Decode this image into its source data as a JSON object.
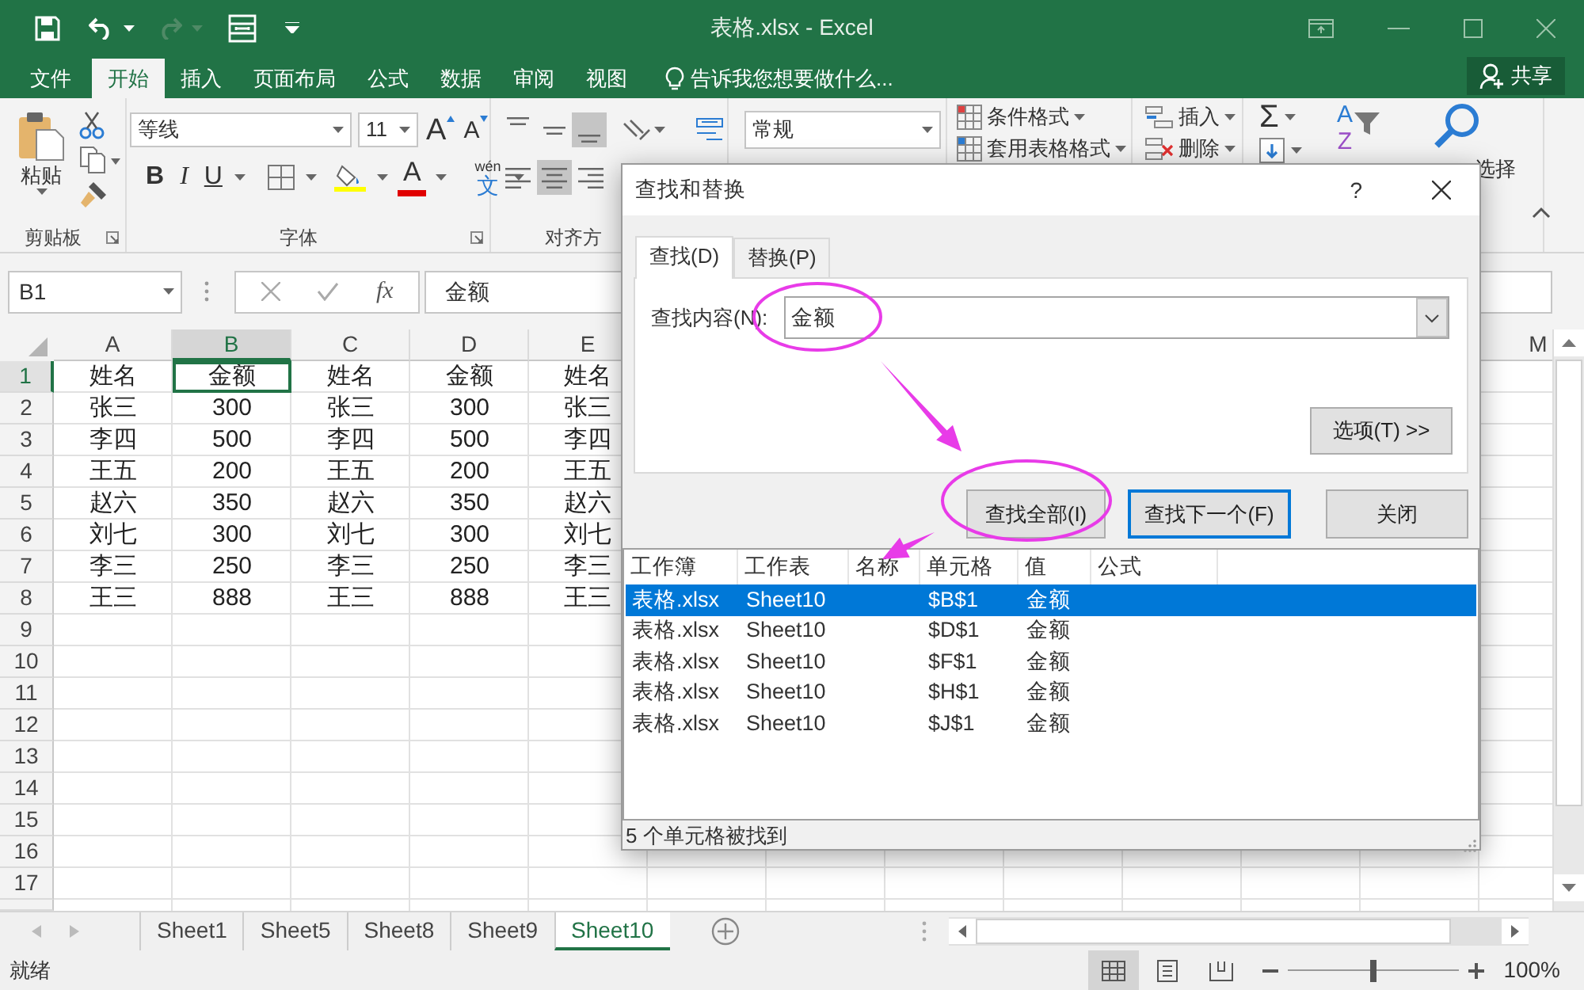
{
  "title_bar": {
    "title": "表格.xlsx - Excel"
  },
  "ribbon_tabs": [
    {
      "label": "文件",
      "selected": false
    },
    {
      "label": "开始",
      "selected": true
    },
    {
      "label": "插入",
      "selected": false
    },
    {
      "label": "页面布局",
      "selected": false
    },
    {
      "label": "公式",
      "selected": false
    },
    {
      "label": "数据",
      "selected": false
    },
    {
      "label": "审阅",
      "selected": false
    },
    {
      "label": "视图",
      "selected": false
    }
  ],
  "tell_me": {
    "label": "告诉我您想要做什么..."
  },
  "share_button": {
    "label": "共享"
  },
  "ribbon": {
    "clipboard": {
      "paste_label": "粘贴",
      "group_label": "剪贴板"
    },
    "font": {
      "font_name": "等线",
      "font_size": "11",
      "grow_label": "A",
      "shrink_label": "A",
      "style_buttons": [
        {
          "label": "B",
          "kind": "bold"
        },
        {
          "label": "I",
          "kind": "italic"
        },
        {
          "label": "U",
          "kind": "underline"
        }
      ],
      "font_color_label": "A",
      "phonetic_top": "wén",
      "phonetic_bottom": "文",
      "group_label": "字体"
    },
    "alignment": {
      "group_label": "对齐方",
      "top_row": [
        {
          "kind": "top",
          "selected": false
        },
        {
          "kind": "middle",
          "selected": false
        },
        {
          "kind": "bottom",
          "selected": true
        }
      ],
      "bottom_row": [
        {
          "kind": "left",
          "selected": false
        },
        {
          "kind": "center",
          "selected": true
        },
        {
          "kind": "right",
          "selected": false
        }
      ]
    },
    "number": {
      "format": "常规"
    },
    "styles": {
      "items": [
        "条件格式",
        "套用表格格式"
      ]
    },
    "cells": {
      "items": [
        "插入",
        "删除"
      ]
    },
    "editing": {
      "sum_label": "Σ",
      "sort_letters": [
        "A",
        "Z"
      ],
      "find_label": "选择"
    }
  },
  "formula_bar": {
    "name_box": "B1",
    "fx": "fx",
    "formula": "金额"
  },
  "sheet": {
    "columns": [
      {
        "label": "A",
        "selected": false
      },
      {
        "label": "B",
        "selected": true
      },
      {
        "label": "C",
        "selected": false
      },
      {
        "label": "D",
        "selected": false
      },
      {
        "label": "E",
        "selected": false
      }
    ],
    "far_columns": [
      {
        "label": "M",
        "selected": false
      }
    ],
    "rows": [
      {
        "label": "1",
        "selected": true,
        "cells": [
          {
            "text": "姓名",
            "selected": false
          },
          {
            "text": "金额",
            "selected": true
          },
          {
            "text": "姓名",
            "selected": false
          },
          {
            "text": "金额",
            "selected": false
          },
          {
            "text": "姓名",
            "selected": false
          }
        ]
      },
      {
        "label": "2",
        "selected": false,
        "cells": [
          {
            "text": "张三",
            "selected": false
          },
          {
            "text": "300",
            "selected": false
          },
          {
            "text": "张三",
            "selected": false
          },
          {
            "text": "300",
            "selected": false
          },
          {
            "text": "张三",
            "selected": false
          }
        ]
      },
      {
        "label": "3",
        "selected": false,
        "cells": [
          {
            "text": "李四",
            "selected": false
          },
          {
            "text": "500",
            "selected": false
          },
          {
            "text": "李四",
            "selected": false
          },
          {
            "text": "500",
            "selected": false
          },
          {
            "text": "李四",
            "selected": false
          }
        ]
      },
      {
        "label": "4",
        "selected": false,
        "cells": [
          {
            "text": "王五",
            "selected": false
          },
          {
            "text": "200",
            "selected": false
          },
          {
            "text": "王五",
            "selected": false
          },
          {
            "text": "200",
            "selected": false
          },
          {
            "text": "王五",
            "selected": false
          }
        ]
      },
      {
        "label": "5",
        "selected": false,
        "cells": [
          {
            "text": "赵六",
            "selected": false
          },
          {
            "text": "350",
            "selected": false
          },
          {
            "text": "赵六",
            "selected": false
          },
          {
            "text": "350",
            "selected": false
          },
          {
            "text": "赵六",
            "selected": false
          }
        ]
      },
      {
        "label": "6",
        "selected": false,
        "cells": [
          {
            "text": "刘七",
            "selected": false
          },
          {
            "text": "300",
            "selected": false
          },
          {
            "text": "刘七",
            "selected": false
          },
          {
            "text": "300",
            "selected": false
          },
          {
            "text": "刘七",
            "selected": false
          }
        ]
      },
      {
        "label": "7",
        "selected": false,
        "cells": [
          {
            "text": "李三",
            "selected": false
          },
          {
            "text": "250",
            "selected": false
          },
          {
            "text": "李三",
            "selected": false
          },
          {
            "text": "250",
            "selected": false
          },
          {
            "text": "李三",
            "selected": false
          }
        ]
      },
      {
        "label": "8",
        "selected": false,
        "cells": [
          {
            "text": "王三",
            "selected": false
          },
          {
            "text": "888",
            "selected": false
          },
          {
            "text": "王三",
            "selected": false
          },
          {
            "text": "888",
            "selected": false
          },
          {
            "text": "王三",
            "selected": false
          }
        ]
      },
      {
        "label": "9",
        "selected": false,
        "cells": []
      },
      {
        "label": "10",
        "selected": false,
        "cells": []
      },
      {
        "label": "11",
        "selected": false,
        "cells": []
      },
      {
        "label": "12",
        "selected": false,
        "cells": []
      },
      {
        "label": "13",
        "selected": false,
        "cells": []
      },
      {
        "label": "14",
        "selected": false,
        "cells": []
      },
      {
        "label": "15",
        "selected": false,
        "cells": []
      },
      {
        "label": "16",
        "selected": false,
        "cells": []
      },
      {
        "label": "17",
        "selected": false,
        "cells": []
      }
    ]
  },
  "sheet_tabs": [
    {
      "label": "Sheet1",
      "selected": false
    },
    {
      "label": "Sheet5",
      "selected": false
    },
    {
      "label": "Sheet8",
      "selected": false
    },
    {
      "label": "Sheet9",
      "selected": false
    },
    {
      "label": "Sheet10",
      "selected": true
    }
  ],
  "status_bar": {
    "text": "就绪",
    "views": [
      {
        "kind": "normal",
        "selected": true
      },
      {
        "kind": "page_layout",
        "selected": false
      },
      {
        "kind": "page_break",
        "selected": false
      }
    ],
    "zoom": {
      "level": 0.5,
      "reading": "100%"
    }
  },
  "dialog": {
    "title": "查找和替换",
    "help": "?",
    "tabs": [
      {
        "label": "查找(D)",
        "selected": true
      },
      {
        "label": "替换(P)",
        "selected": false
      }
    ],
    "find_label": "查找内容(N):",
    "find_value": "金额",
    "options_button": "选项(T) >>",
    "buttons": [
      {
        "label": "查找全部(I)",
        "default": false
      },
      {
        "label": "查找下一个(F)",
        "default": true
      },
      {
        "label": "关闭",
        "default": false
      }
    ],
    "results": {
      "columns": [
        "工作簿",
        "工作表",
        "名称",
        "单元格",
        "值",
        "公式"
      ],
      "rows": [
        {
          "selected": true,
          "cells": [
            "表格.xlsx",
            "Sheet10",
            "",
            "$B$1",
            "金额",
            ""
          ]
        },
        {
          "selected": false,
          "cells": [
            "表格.xlsx",
            "Sheet10",
            "",
            "$D$1",
            "金额",
            ""
          ]
        },
        {
          "selected": false,
          "cells": [
            "表格.xlsx",
            "Sheet10",
            "",
            "$F$1",
            "金额",
            ""
          ]
        },
        {
          "selected": false,
          "cells": [
            "表格.xlsx",
            "Sheet10",
            "",
            "$H$1",
            "金额",
            ""
          ]
        },
        {
          "selected": false,
          "cells": [
            "表格.xlsx",
            "Sheet10",
            "",
            "$J$1",
            "金额",
            ""
          ]
        }
      ]
    },
    "status": "5 个单元格被找到"
  },
  "annotations": [
    {
      "kind": "ellipse"
    },
    {
      "kind": "arrow"
    },
    {
      "kind": "ellipse"
    },
    {
      "kind": "arrow"
    }
  ]
}
